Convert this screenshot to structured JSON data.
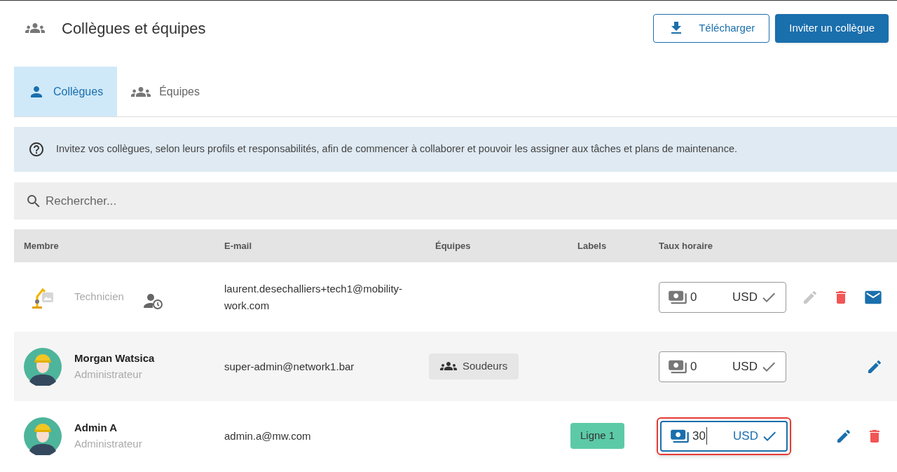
{
  "header": {
    "title": "Collègues et équipes",
    "download_button": "Télécharger",
    "invite_button": "Inviter un collègue"
  },
  "tabs": [
    {
      "label": "Collègues",
      "kind": "person",
      "selected": true
    },
    {
      "label": "Équipes",
      "kind": "group",
      "selected": false
    }
  ],
  "info_banner": "Invitez vos collègues, selon leurs profils et responsabilités, afin de commencer à collaborer et pouvoir les assigner aux tâches et plans de maintenance.",
  "search": {
    "placeholder": "Rechercher..."
  },
  "table": {
    "columns": [
      "Membre",
      "E-mail",
      "Équipes",
      "Labels",
      "Taux horaire"
    ],
    "rows": [
      {
        "kind": "image",
        "role": "Technicien",
        "pending": true,
        "email": "laurent.desechalliers+tech1@mobility-work.com",
        "teams": [],
        "labels": [],
        "rate": "0",
        "currency": "USD",
        "focused": false,
        "actions": [
          {
            "kind": "edit",
            "disabled": true
          },
          {
            "kind": "delete",
            "disabled": false
          },
          {
            "kind": "mail",
            "disabled": false
          }
        ]
      },
      {
        "kind": "person",
        "name": "Morgan Watsica",
        "role": "Administrateur",
        "pending": false,
        "email": "super-admin@network1.bar",
        "teams": [
          "Soudeurs"
        ],
        "labels": [],
        "rate": "0",
        "currency": "USD",
        "focused": false,
        "actions": [
          {
            "kind": "edit",
            "disabled": false
          }
        ]
      },
      {
        "kind": "person",
        "name": "Admin A",
        "role": "Administrateur",
        "pending": false,
        "email": "admin.a@mw.com",
        "teams": [],
        "labels": [
          {
            "text": "Ligne 1",
            "color": "#5ccaa7"
          }
        ],
        "rate": "30",
        "currency": "USD",
        "focused": true,
        "actions": [
          {
            "kind": "edit",
            "disabled": false
          },
          {
            "kind": "delete",
            "disabled": false
          }
        ]
      }
    ]
  }
}
